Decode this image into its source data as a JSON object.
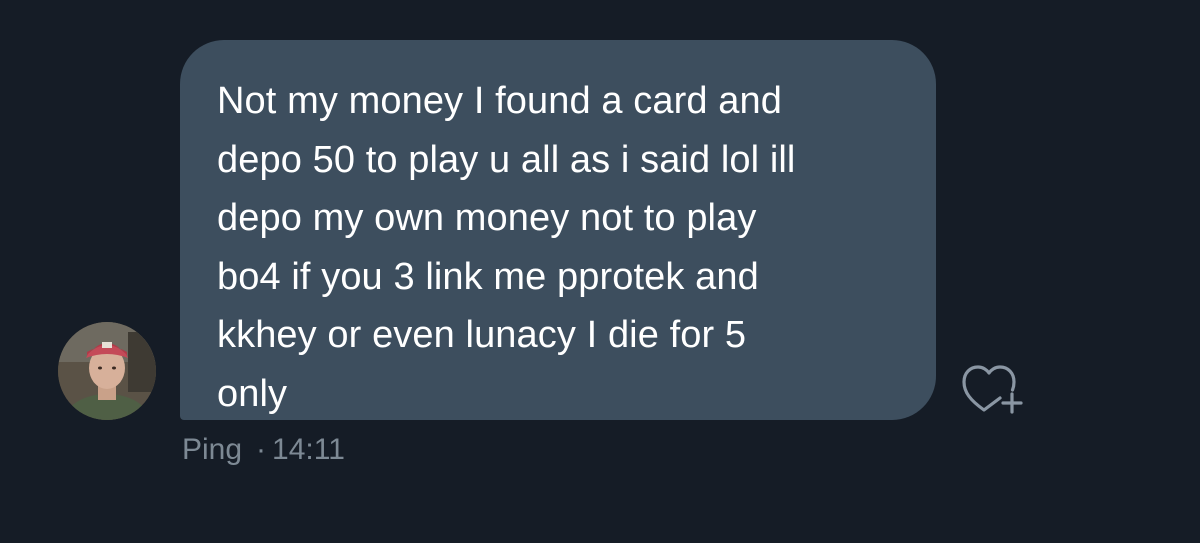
{
  "message": {
    "text": "Not my money I found a card and\ndepo 50 to play u all as i said lol ill\ndepo my own money not to play\nbo4 if you 3 link me pprotek and\nkkhey or even lunacy I die for 5\nonly",
    "sender": "Ping",
    "separator": "·",
    "time": "14:11"
  },
  "icons": {
    "react": "heart-plus-icon",
    "avatar": "profile-photo"
  },
  "colors": {
    "background": "#151c26",
    "bubble": "#3d4e5e",
    "text": "#ffffff",
    "meta": "#7d8994",
    "icon": "#8a96a3"
  }
}
